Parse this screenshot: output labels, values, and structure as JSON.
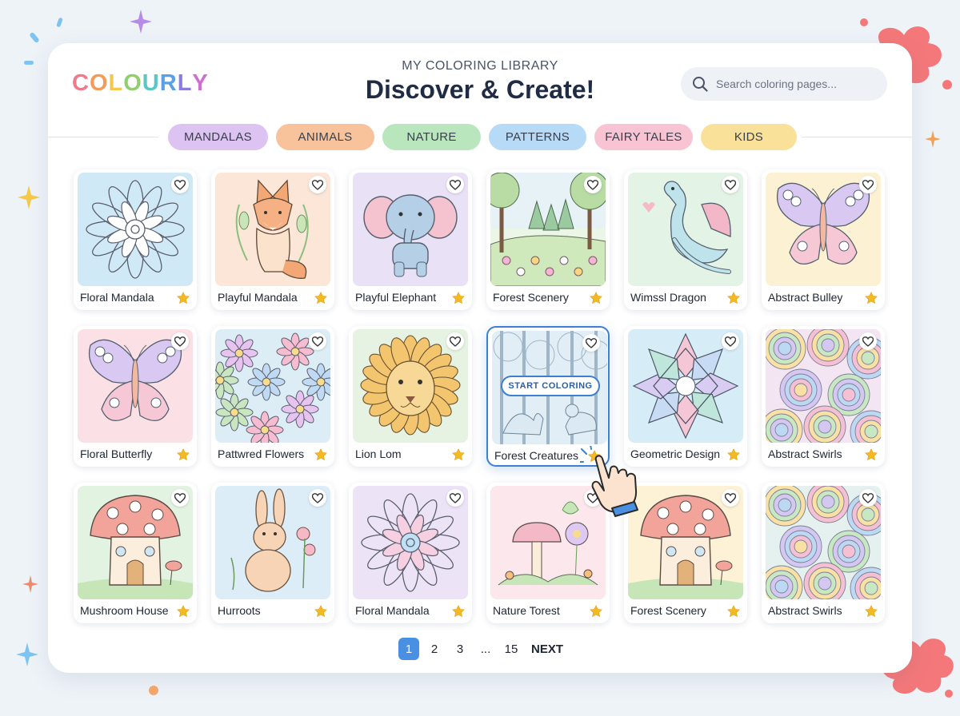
{
  "brand": {
    "name": "COLOURLY",
    "letter_colors": [
      "#f07a8a",
      "#f59b5a",
      "#f3c84c",
      "#8fcf6e",
      "#5bc6c6",
      "#5aa0e8",
      "#8b7ce0",
      "#d06fd2"
    ]
  },
  "header": {
    "subtitle": "MY COLORING LIBRARY",
    "title": "Discover & Create!"
  },
  "search": {
    "placeholder": "Search coloring pages..."
  },
  "categories": [
    {
      "label": "MANDALAS",
      "color": "#dcc3f2"
    },
    {
      "label": "ANIMALS",
      "color": "#f8c39b"
    },
    {
      "label": "NATURE",
      "color": "#b9e6bd"
    },
    {
      "label": "PATTERNS",
      "color": "#b7daf6"
    },
    {
      "label": "FAIRY TALES",
      "color": "#f8c3d3"
    },
    {
      "label": "KIDS",
      "color": "#f9e19a"
    }
  ],
  "cards": [
    {
      "title": "Floral Mandala",
      "bg": "#cfeaf6",
      "kind": "mandala"
    },
    {
      "title": "Playful Mandala",
      "bg": "#fbe6d8",
      "kind": "fox"
    },
    {
      "title": "Playful Elephant",
      "bg": "#e9e1f6",
      "kind": "elephant"
    },
    {
      "title": "Forest Scenery",
      "bg": "#ecf6e6",
      "kind": "forest"
    },
    {
      "title": "Wimssl Dragon",
      "bg": "#e3f3e6",
      "kind": "dragon"
    },
    {
      "title": "Abstract Bulley",
      "bg": "#fdf1d3",
      "kind": "butterfly"
    },
    {
      "title": "Floral Butterfly",
      "bg": "#fbe1e6",
      "kind": "butterfly"
    },
    {
      "title": "Pattwred Flowers",
      "bg": "#dcedf5",
      "kind": "flowers"
    },
    {
      "title": "Lion Lom",
      "bg": "#e6f3e2",
      "kind": "lion"
    },
    {
      "title": "Forest Creatures",
      "bg": "#e2eef6",
      "kind": "forest-creatures",
      "active": true,
      "cta": "START COLORING"
    },
    {
      "title": "Geometric Design",
      "bg": "#d6ecf7",
      "kind": "geometric"
    },
    {
      "title": "Abstract Swirls",
      "bg": "#f3e6f2",
      "kind": "swirls"
    },
    {
      "title": "Mushroom House",
      "bg": "#e3f3e2",
      "kind": "mushroom"
    },
    {
      "title": "Hurroots",
      "bg": "#dcedf8",
      "kind": "bunny"
    },
    {
      "title": "Floral Mandala",
      "bg": "#ece3f7",
      "kind": "mandala2"
    },
    {
      "title": "Nature Torest",
      "bg": "#fbe7ec",
      "kind": "nature"
    },
    {
      "title": "Forest Scenery",
      "bg": "#fdf2d6",
      "kind": "mushroom"
    },
    {
      "title": "Abstract Swirls",
      "bg": "#e4f1ee",
      "kind": "swirls"
    }
  ],
  "pagination": {
    "pages": [
      "1",
      "2",
      "3",
      "...",
      "15"
    ],
    "current": "1",
    "next_label": "NEXT"
  },
  "icons": {
    "search": "search-icon",
    "heart": "heart-icon",
    "star": "star-icon",
    "cursor": "pointer-hand-icon"
  }
}
